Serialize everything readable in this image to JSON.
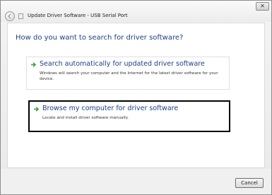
{
  "window": {
    "title": "Update Driver Software - USB Serial Port",
    "close_glyph": "✕"
  },
  "content": {
    "question": "How do you want to search for driver software?",
    "options": [
      {
        "title": "Search automatically for updated driver software",
        "description": "Windows will search your computer and the Internet for the latest driver software for your device.",
        "icon": "green-arrow-icon"
      },
      {
        "title": "Browse my computer for driver software",
        "description": "Locate and install driver software manually.",
        "icon": "green-arrow-icon"
      }
    ]
  },
  "footer": {
    "cancel_label": "Cancel"
  },
  "colors": {
    "accent_text": "#1e3f85",
    "arrow": "#3aa43a",
    "selection_border": "#000000"
  }
}
